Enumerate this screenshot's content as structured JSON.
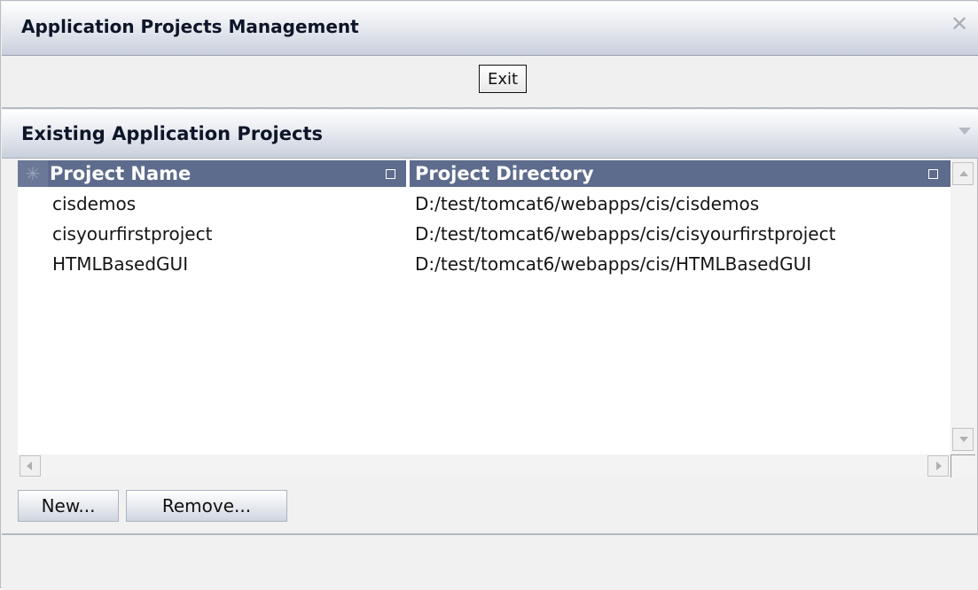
{
  "window": {
    "title": "Application Projects Management",
    "close_icon": "close-icon"
  },
  "toolbar": {
    "exit_label": "Exit"
  },
  "section": {
    "title": "Existing Application Projects",
    "collapse_icon": "collapse-icon"
  },
  "grid": {
    "columns": [
      {
        "label": "Project Name"
      },
      {
        "label": "Project Directory"
      }
    ],
    "rows": [
      {
        "name": "cisdemos",
        "directory": "D:/test/tomcat6/webapps/cis/cisdemos"
      },
      {
        "name": "cisyourfirstproject",
        "directory": "D:/test/tomcat6/webapps/cis/cisyourfirstproject"
      },
      {
        "name": "HTMLBasedGUI",
        "directory": "D:/test/tomcat6/webapps/cis/HTMLBasedGUI"
      }
    ],
    "select_all_icon": "asterisk-icon",
    "sort_icon": "square-icon"
  },
  "actions": {
    "new_label": "New...",
    "remove_label": "Remove..."
  },
  "colors": {
    "header_bg": "#5d6b8c",
    "titlebar_end": "#c9cfdd"
  }
}
